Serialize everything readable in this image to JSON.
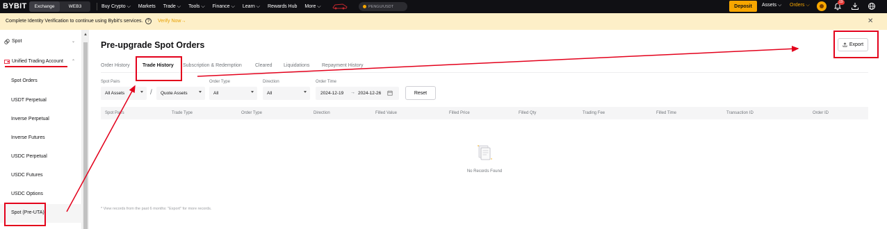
{
  "topnav": {
    "logo": "BYBIT",
    "segment": [
      "Exchange",
      "WEB3"
    ],
    "items": [
      "Buy Crypto ⌵",
      "Markets",
      "Trade ⌵",
      "Tools ⌵",
      "Finance ⌵",
      "Learn ⌵",
      "Rewards Hub",
      "More ⌵"
    ],
    "search_placeholder": "PENGU/USDT",
    "deposit": "Deposit",
    "assets": "Assets ⌵",
    "orders": "Orders ⌵",
    "notifications_count": "19"
  },
  "banner": {
    "text": "Complete Identity Verification to continue using Bybit's services.",
    "help": "?",
    "link": "Verify Now→",
    "close": "✕"
  },
  "sidebar": {
    "items": [
      {
        "label": "Spot",
        "icon": "spot-icon",
        "chevron": "⌄"
      },
      {
        "label": "Unified Trading Account",
        "icon": "uta-icon",
        "chevron": "⌃"
      },
      {
        "label": "Spot Orders"
      },
      {
        "label": "USDT Perpetual"
      },
      {
        "label": "Inverse Perpetual"
      },
      {
        "label": "Inverse Futures"
      },
      {
        "label": "USDC Perpetual"
      },
      {
        "label": "USDC Futures"
      },
      {
        "label": "USDC Options"
      },
      {
        "label": "Spot (Pre-UTA)"
      }
    ]
  },
  "page": {
    "title": "Pre-upgrade Spot Orders",
    "export": "Export",
    "tabs": [
      "Order History",
      "Trade History",
      "Subscription & Redemption",
      "Cleared",
      "Liquidations",
      "Repayment History"
    ],
    "active_tab": "Trade History"
  },
  "filters": {
    "spot_pairs_label": "Spot Pairs",
    "spot_pairs_value": "All Assets",
    "quote_value": "Quote Assets",
    "separator": "/",
    "order_type_label": "Order Type",
    "order_type_value": "All",
    "direction_label": "Direction",
    "direction_value": "All",
    "order_time_label": "Order Time",
    "date_from": "2024-12-19",
    "date_arrow": "→",
    "date_to": "2024-12-26",
    "reset": "Reset"
  },
  "table": {
    "columns": [
      "Spot Pairs",
      "Trade Type",
      "Order Type",
      "Direction",
      "Filled Value",
      "Filled Price",
      "Filled Qty",
      "Trading Fee",
      "Filled Time",
      "Transaction ID",
      "Order ID"
    ],
    "empty": "No Records Found"
  },
  "note": "* View records from the past 6 months: \"Export\" for more records.",
  "colors": {
    "accent": "#f7a600",
    "annotation": "#e3001b",
    "nav_bg": "#101014",
    "banner_bg": "#fdefc8"
  }
}
